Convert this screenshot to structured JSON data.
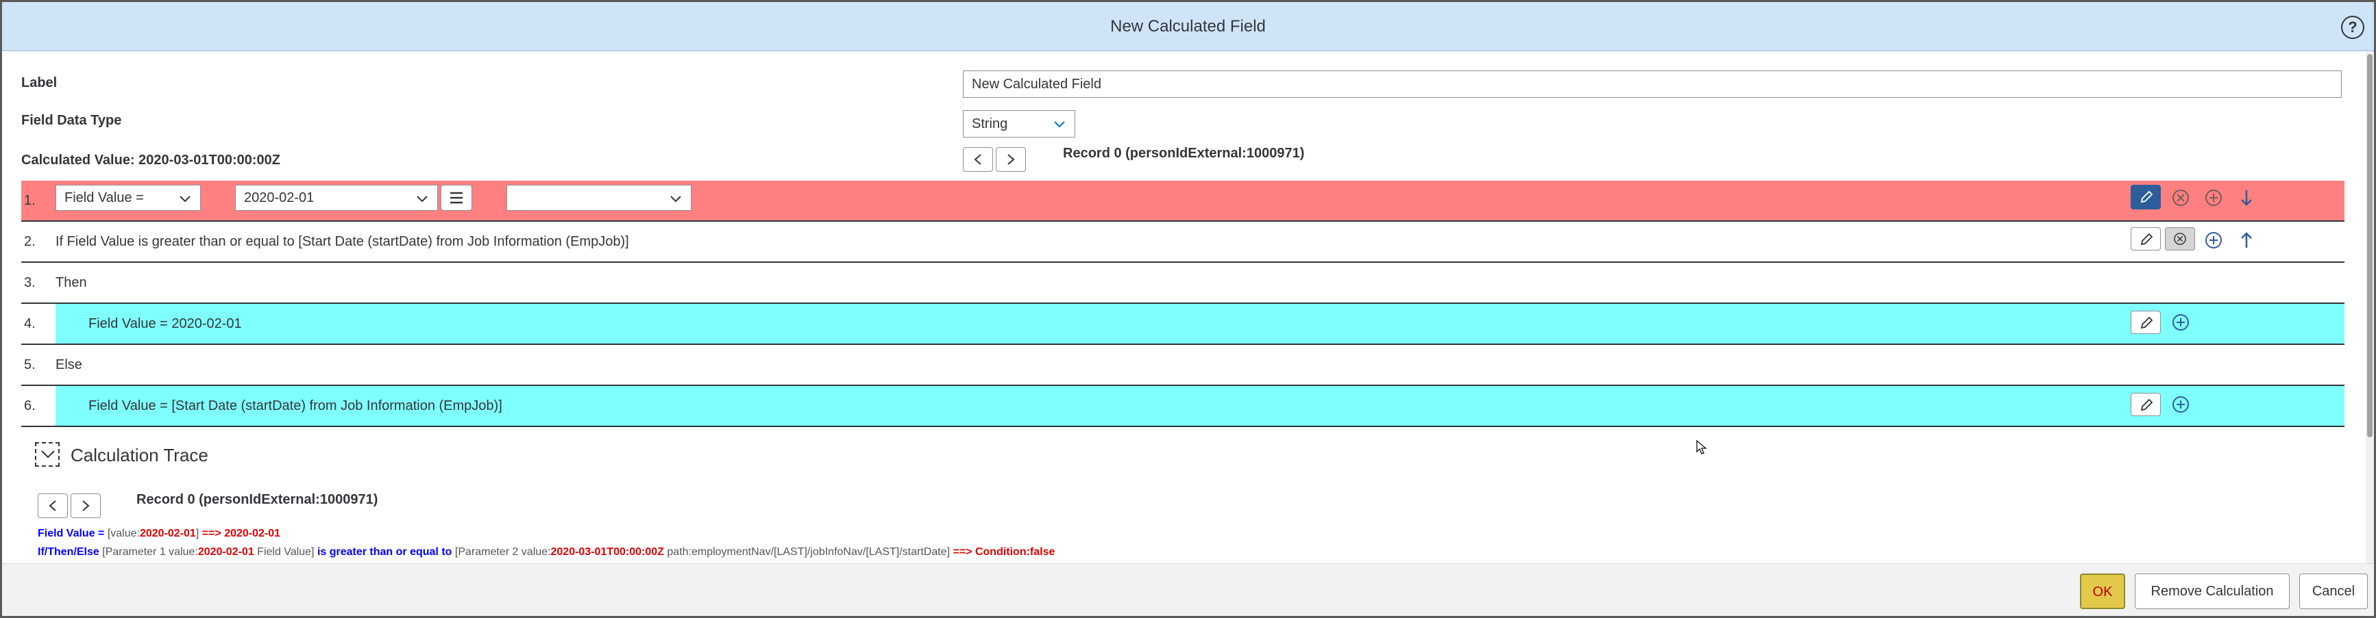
{
  "dialog": {
    "title": "New Calculated Field",
    "help_label": "?"
  },
  "form": {
    "label_caption": "Label",
    "label_value": "New Calculated Field",
    "datatype_caption": "Field Data Type",
    "datatype_value": "String",
    "calculated_value": "Calculated Value: 2020-03-01T00:00:00Z",
    "record_label": "Record 0 (personIdExternal:1000971)"
  },
  "rows": [
    {
      "num": "1.",
      "select_operator": "Field Value =",
      "select_value": "2020-02-01",
      "select_third": ""
    },
    {
      "num": "2.",
      "text": "If Field Value is greater than or equal to [Start Date (startDate) from Job Information (EmpJob)]"
    },
    {
      "num": "3.",
      "text": "Then"
    },
    {
      "num": "4.",
      "text": "Field Value = 2020-02-01"
    },
    {
      "num": "5.",
      "text": "Else"
    },
    {
      "num": "6.",
      "text": "Field Value = [Start Date (startDate) from Job Information (EmpJob)]"
    }
  ],
  "trace": {
    "title": "Calculation Trace",
    "record_label": "Record 0 (personIdExternal:1000971)",
    "line1": {
      "a": "Field Value =",
      "b": "[value:",
      "c": "2020-02-01",
      "d": "]",
      "e": "==> 2020-02-01"
    },
    "line2": {
      "a": "If/Then/Else",
      "b": "[Parameter 1 value:",
      "c": "2020-02-01",
      "d": "Field Value]",
      "e": "is greater than or equal to",
      "f": "[Parameter 2 value:",
      "g": "2020-03-01T00:00:00Z",
      "h": "path:employmentNav/[LAST]/jobInfoNav/[LAST]/startDate]",
      "i": "==> Condition:false"
    }
  },
  "footer": {
    "ok": "OK",
    "remove": "Remove Calculation",
    "cancel": "Cancel"
  },
  "colors": {
    "title_bar": "#cfe4f7",
    "row_highlight_red": "#ff8080",
    "row_highlight_cyan": "#80ffff",
    "edit_active": "#2d5d9a"
  }
}
